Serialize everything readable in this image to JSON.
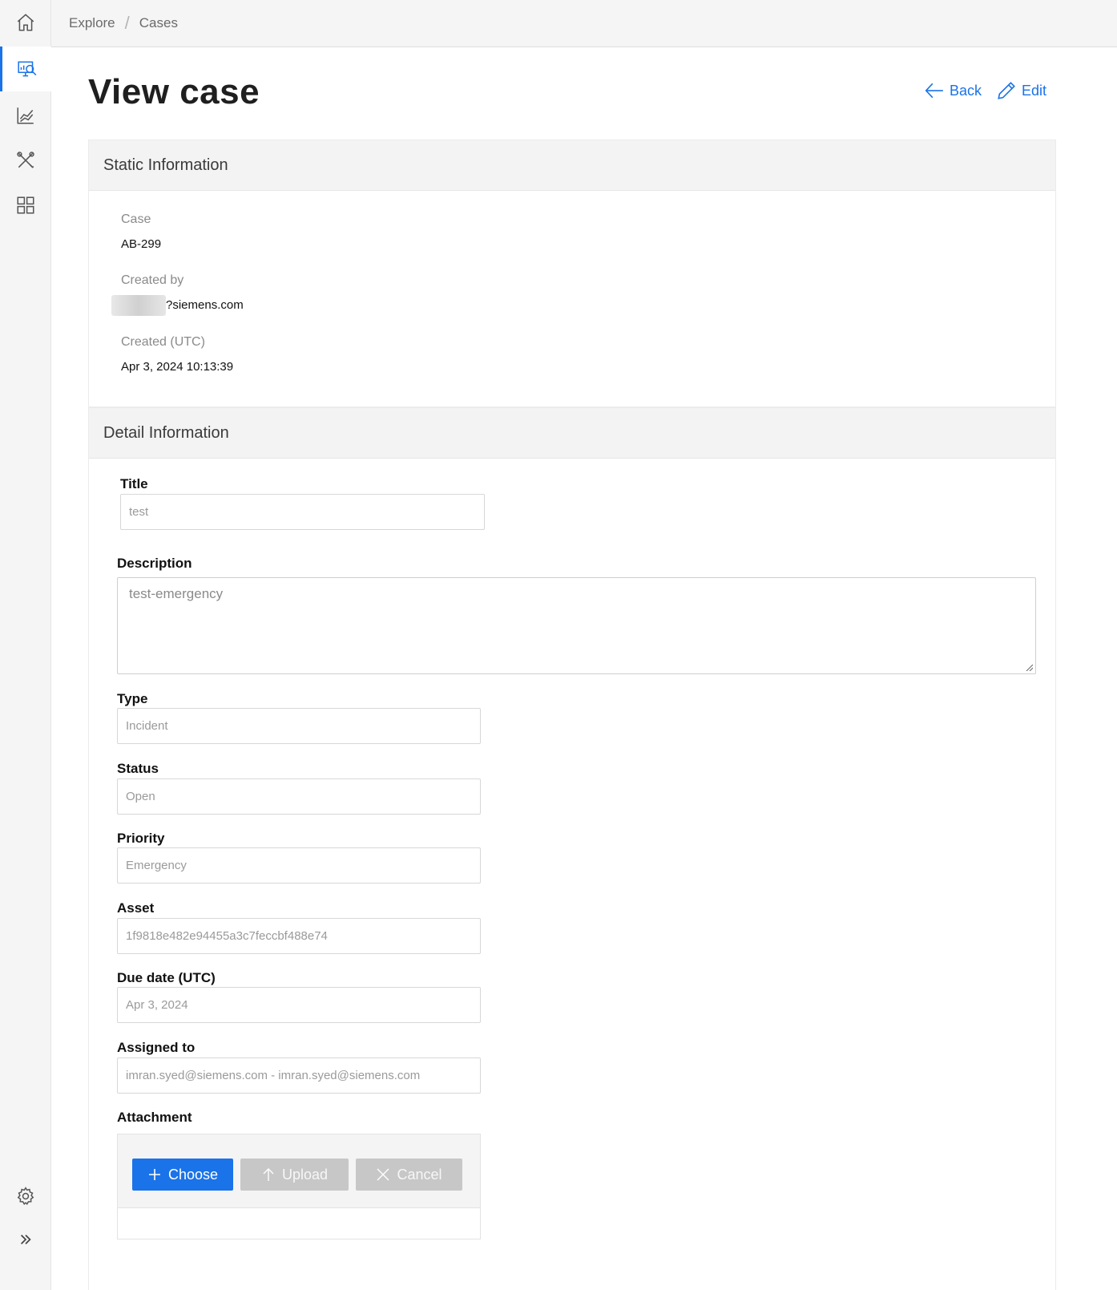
{
  "nav": {
    "items": [
      {
        "name": "home",
        "icon": "home-icon"
      },
      {
        "name": "explore",
        "icon": "monitor-search-icon",
        "active": true
      },
      {
        "name": "analytics",
        "icon": "line-chart-icon"
      },
      {
        "name": "tools",
        "icon": "tools-icon"
      },
      {
        "name": "apps",
        "icon": "grid-icon"
      }
    ],
    "bottom": [
      {
        "name": "settings",
        "icon": "gear-icon"
      },
      {
        "name": "expand",
        "icon": "double-chevron-right-icon"
      }
    ]
  },
  "breadcrumb": {
    "items": [
      "Explore",
      "Cases"
    ],
    "separator": "/"
  },
  "header": {
    "title": "View case",
    "back_label": "Back",
    "edit_label": "Edit"
  },
  "static_info": {
    "heading": "Static Information",
    "case_label": "Case",
    "case_value": "AB-299",
    "created_by_label": "Created by",
    "created_by_value": "?siemens.com",
    "created_label": "Created (UTC)",
    "created_value": "Apr 3, 2024 10:13:39"
  },
  "detail_info": {
    "heading": "Detail Information",
    "title_label": "Title",
    "title_value": "test",
    "description_label": "Description",
    "description_value": "test-emergency",
    "type_label": "Type",
    "type_value": "Incident",
    "status_label": "Status",
    "status_value": "Open",
    "priority_label": "Priority",
    "priority_value": "Emergency",
    "asset_label": "Asset",
    "asset_value": "1f9818e482e94455a3c7feccbf488e74",
    "due_label": "Due date (UTC)",
    "due_value": "Apr 3, 2024",
    "assigned_label": "Assigned to",
    "assigned_value": "imran.syed@siemens.com - imran.syed@siemens.com",
    "attachment_label": "Attachment",
    "choose_label": "Choose",
    "upload_label": "Upload",
    "cancel_label": "Cancel"
  },
  "colors": {
    "accent": "#1a73e8",
    "disabled": "#c7c7c7",
    "panel_header": "#f3f3f3"
  }
}
